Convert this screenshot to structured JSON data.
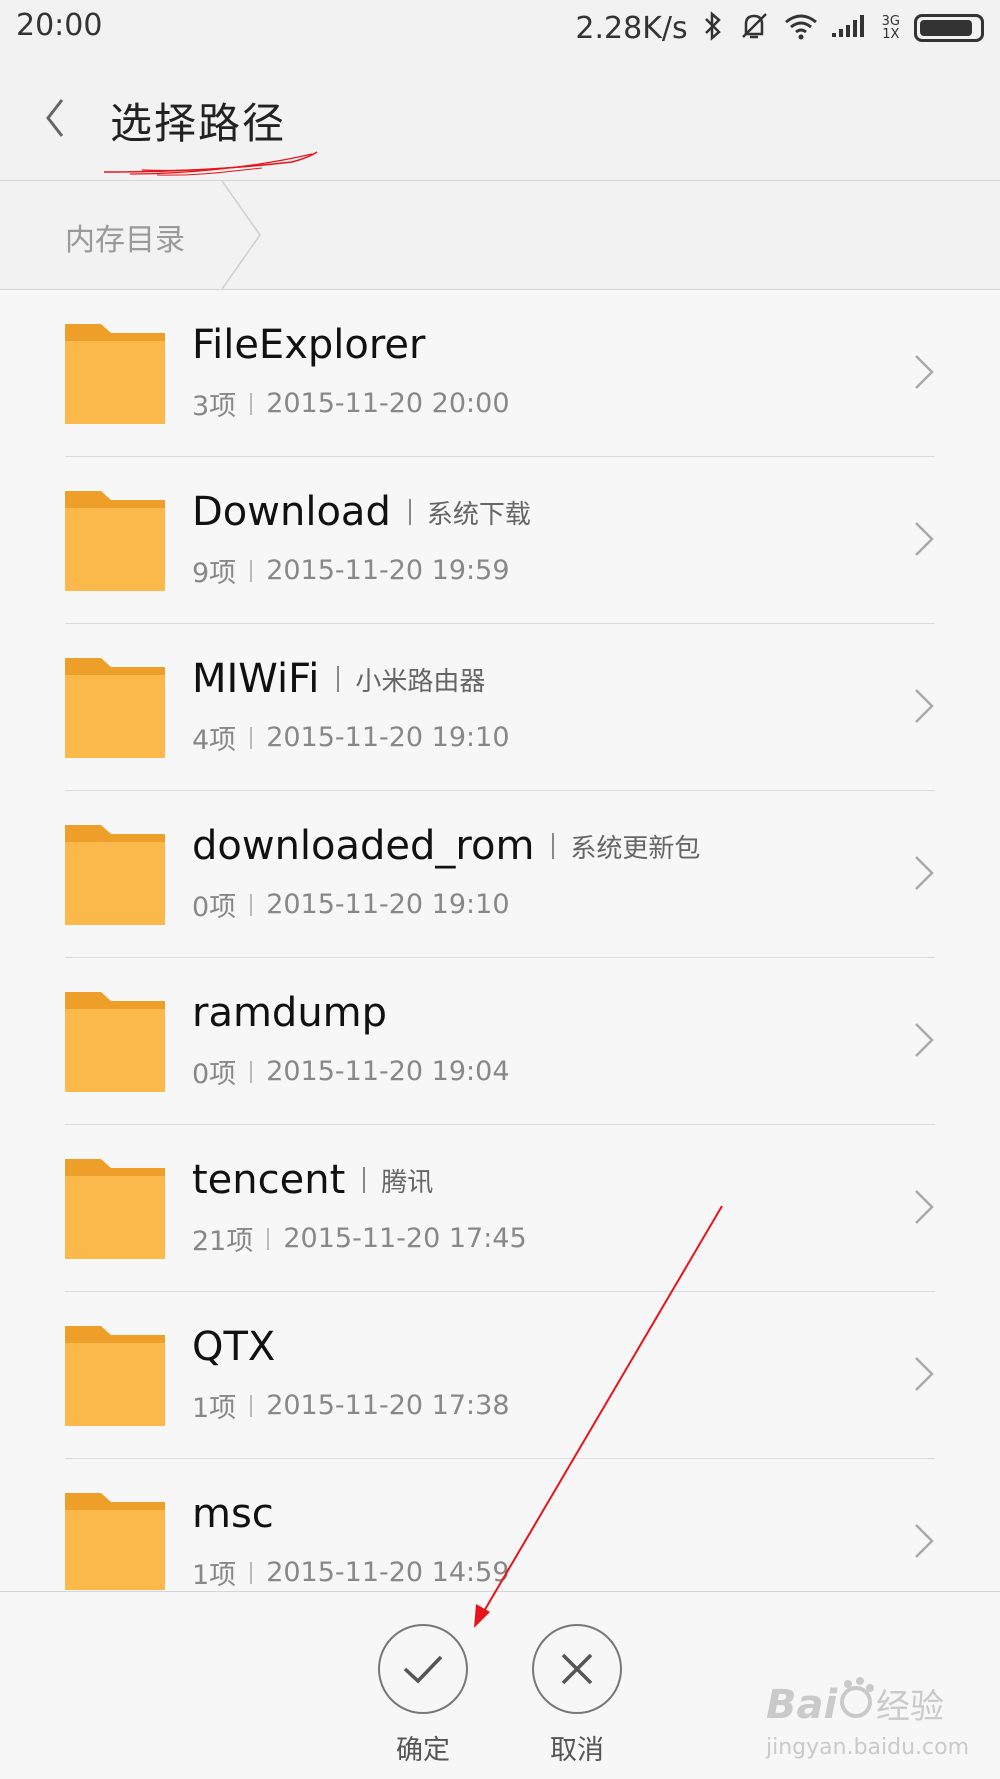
{
  "status_bar": {
    "time": "20:00",
    "speed": "2.28K/s",
    "icons": [
      "bluetooth-icon",
      "mute-icon",
      "wifi-icon",
      "signal-icon",
      "battery-icon"
    ],
    "network_top": "3G",
    "network_bottom": "1X"
  },
  "header": {
    "title": "选择路径",
    "back_icon": "chevron-left-icon"
  },
  "breadcrumb": {
    "items": [
      {
        "label": "内存目录"
      }
    ]
  },
  "files": [
    {
      "name": "FileExplorer",
      "alias": "",
      "count": "3项",
      "date": "2015-11-20 20:00"
    },
    {
      "name": "Download",
      "alias": "系统下载",
      "count": "9项",
      "date": "2015-11-20 19:59"
    },
    {
      "name": "MIWiFi",
      "alias": "小米路由器",
      "count": "4项",
      "date": "2015-11-20 19:10"
    },
    {
      "name": "downloaded_rom",
      "alias": "系统更新包",
      "count": "0项",
      "date": "2015-11-20 19:10"
    },
    {
      "name": "ramdump",
      "alias": "",
      "count": "0项",
      "date": "2015-11-20 19:04"
    },
    {
      "name": "tencent",
      "alias": "腾讯",
      "count": "21项",
      "date": "2015-11-20 17:45"
    },
    {
      "name": "QTX",
      "alias": "",
      "count": "1项",
      "date": "2015-11-20 17:38"
    },
    {
      "name": "msc",
      "alias": "",
      "count": "1项",
      "date": "2015-11-20 14:59"
    }
  ],
  "actions": {
    "confirm": {
      "label": "确定",
      "icon": "check-icon"
    },
    "cancel": {
      "label": "取消",
      "icon": "close-icon"
    }
  },
  "colors": {
    "folder": "#fbb84b",
    "folder_tab": "#ee9f2a",
    "annotation": "#e8141b"
  },
  "watermark": {
    "brand": "Bai",
    "brand_suffix": "经验",
    "url": "jingyan.baidu.com"
  }
}
